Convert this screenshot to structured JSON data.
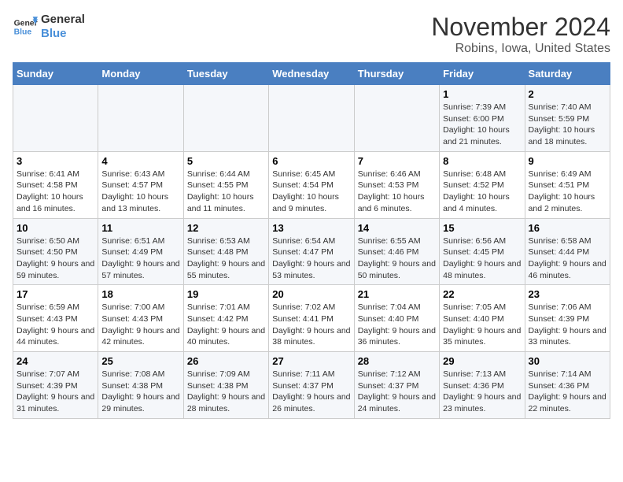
{
  "logo": {
    "text1": "General",
    "text2": "Blue"
  },
  "title": "November 2024",
  "location": "Robins, Iowa, United States",
  "weekdays": [
    "Sunday",
    "Monday",
    "Tuesday",
    "Wednesday",
    "Thursday",
    "Friday",
    "Saturday"
  ],
  "weeks": [
    [
      {
        "day": "",
        "info": ""
      },
      {
        "day": "",
        "info": ""
      },
      {
        "day": "",
        "info": ""
      },
      {
        "day": "",
        "info": ""
      },
      {
        "day": "",
        "info": ""
      },
      {
        "day": "1",
        "info": "Sunrise: 7:39 AM\nSunset: 6:00 PM\nDaylight: 10 hours and 21 minutes."
      },
      {
        "day": "2",
        "info": "Sunrise: 7:40 AM\nSunset: 5:59 PM\nDaylight: 10 hours and 18 minutes."
      }
    ],
    [
      {
        "day": "3",
        "info": "Sunrise: 6:41 AM\nSunset: 4:58 PM\nDaylight: 10 hours and 16 minutes."
      },
      {
        "day": "4",
        "info": "Sunrise: 6:43 AM\nSunset: 4:57 PM\nDaylight: 10 hours and 13 minutes."
      },
      {
        "day": "5",
        "info": "Sunrise: 6:44 AM\nSunset: 4:55 PM\nDaylight: 10 hours and 11 minutes."
      },
      {
        "day": "6",
        "info": "Sunrise: 6:45 AM\nSunset: 4:54 PM\nDaylight: 10 hours and 9 minutes."
      },
      {
        "day": "7",
        "info": "Sunrise: 6:46 AM\nSunset: 4:53 PM\nDaylight: 10 hours and 6 minutes."
      },
      {
        "day": "8",
        "info": "Sunrise: 6:48 AM\nSunset: 4:52 PM\nDaylight: 10 hours and 4 minutes."
      },
      {
        "day": "9",
        "info": "Sunrise: 6:49 AM\nSunset: 4:51 PM\nDaylight: 10 hours and 2 minutes."
      }
    ],
    [
      {
        "day": "10",
        "info": "Sunrise: 6:50 AM\nSunset: 4:50 PM\nDaylight: 9 hours and 59 minutes."
      },
      {
        "day": "11",
        "info": "Sunrise: 6:51 AM\nSunset: 4:49 PM\nDaylight: 9 hours and 57 minutes."
      },
      {
        "day": "12",
        "info": "Sunrise: 6:53 AM\nSunset: 4:48 PM\nDaylight: 9 hours and 55 minutes."
      },
      {
        "day": "13",
        "info": "Sunrise: 6:54 AM\nSunset: 4:47 PM\nDaylight: 9 hours and 53 minutes."
      },
      {
        "day": "14",
        "info": "Sunrise: 6:55 AM\nSunset: 4:46 PM\nDaylight: 9 hours and 50 minutes."
      },
      {
        "day": "15",
        "info": "Sunrise: 6:56 AM\nSunset: 4:45 PM\nDaylight: 9 hours and 48 minutes."
      },
      {
        "day": "16",
        "info": "Sunrise: 6:58 AM\nSunset: 4:44 PM\nDaylight: 9 hours and 46 minutes."
      }
    ],
    [
      {
        "day": "17",
        "info": "Sunrise: 6:59 AM\nSunset: 4:43 PM\nDaylight: 9 hours and 44 minutes."
      },
      {
        "day": "18",
        "info": "Sunrise: 7:00 AM\nSunset: 4:43 PM\nDaylight: 9 hours and 42 minutes."
      },
      {
        "day": "19",
        "info": "Sunrise: 7:01 AM\nSunset: 4:42 PM\nDaylight: 9 hours and 40 minutes."
      },
      {
        "day": "20",
        "info": "Sunrise: 7:02 AM\nSunset: 4:41 PM\nDaylight: 9 hours and 38 minutes."
      },
      {
        "day": "21",
        "info": "Sunrise: 7:04 AM\nSunset: 4:40 PM\nDaylight: 9 hours and 36 minutes."
      },
      {
        "day": "22",
        "info": "Sunrise: 7:05 AM\nSunset: 4:40 PM\nDaylight: 9 hours and 35 minutes."
      },
      {
        "day": "23",
        "info": "Sunrise: 7:06 AM\nSunset: 4:39 PM\nDaylight: 9 hours and 33 minutes."
      }
    ],
    [
      {
        "day": "24",
        "info": "Sunrise: 7:07 AM\nSunset: 4:39 PM\nDaylight: 9 hours and 31 minutes."
      },
      {
        "day": "25",
        "info": "Sunrise: 7:08 AM\nSunset: 4:38 PM\nDaylight: 9 hours and 29 minutes."
      },
      {
        "day": "26",
        "info": "Sunrise: 7:09 AM\nSunset: 4:38 PM\nDaylight: 9 hours and 28 minutes."
      },
      {
        "day": "27",
        "info": "Sunrise: 7:11 AM\nSunset: 4:37 PM\nDaylight: 9 hours and 26 minutes."
      },
      {
        "day": "28",
        "info": "Sunrise: 7:12 AM\nSunset: 4:37 PM\nDaylight: 9 hours and 24 minutes."
      },
      {
        "day": "29",
        "info": "Sunrise: 7:13 AM\nSunset: 4:36 PM\nDaylight: 9 hours and 23 minutes."
      },
      {
        "day": "30",
        "info": "Sunrise: 7:14 AM\nSunset: 4:36 PM\nDaylight: 9 hours and 22 minutes."
      }
    ]
  ]
}
